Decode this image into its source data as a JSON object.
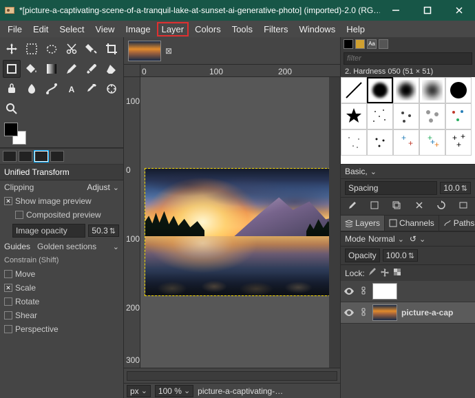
{
  "titlebar": {
    "title": "*[picture-a-captivating-scene-of-a-tranquil-lake-at-sunset-ai-generative-photo] (imported)-2.0 (RG…"
  },
  "menubar": [
    "File",
    "Edit",
    "Select",
    "View",
    "Image",
    "Layer",
    "Colors",
    "Tools",
    "Filters",
    "Windows",
    "Help"
  ],
  "highlighted_menu": "Layer",
  "tool_options": {
    "title": "Unified Transform",
    "clipping_label": "Clipping",
    "clipping_value": "Adjust",
    "show_preview": "Show image preview",
    "composited": "Composited preview",
    "opacity_label": "Image opacity",
    "opacity_value": "50.3",
    "guides_label": "Guides",
    "guides_value": "Golden sections",
    "constrain_label": "Constrain (Shift)",
    "constrain": [
      "Move",
      "Scale",
      "Rotate",
      "Shear",
      "Perspective"
    ],
    "constrain_checked": [
      false,
      true,
      false,
      false,
      false
    ]
  },
  "ruler_h": [
    "0",
    "100",
    "200"
  ],
  "ruler_v": [
    "100",
    "0",
    "100",
    "200",
    "300"
  ],
  "status": {
    "unit": "px",
    "zoom": "100 %",
    "filename": "picture-a-captivating-…"
  },
  "right": {
    "filter_placeholder": "filter",
    "brush_name": "2. Hardness 050 (51 × 51)",
    "basic": "Basic,",
    "spacing_label": "Spacing",
    "spacing_value": "10.0",
    "tabs": [
      "Layers",
      "Channels",
      "Paths"
    ],
    "mode_label": "Mode",
    "mode_value": "Normal",
    "opacity_label": "Opacity",
    "opacity_value": "100.0",
    "lock_label": "Lock:",
    "layers": [
      {
        "name": "",
        "sel": false
      },
      {
        "name": "picture-a-cap",
        "sel": true
      }
    ]
  }
}
